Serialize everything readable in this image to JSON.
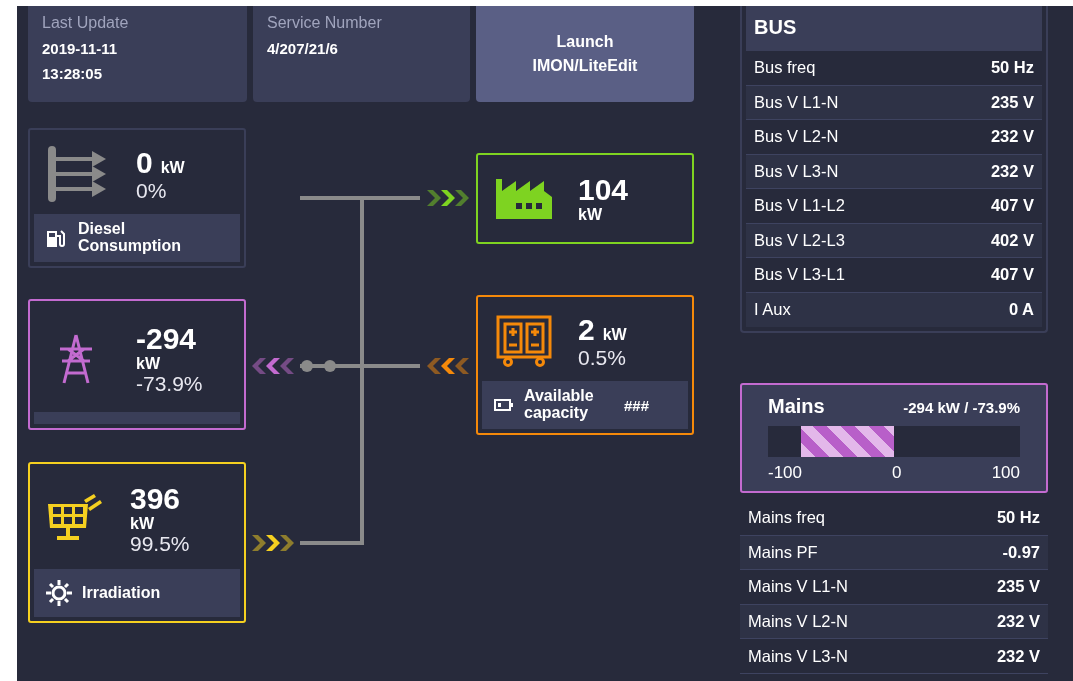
{
  "info_cards": [
    {
      "label": "Last Update",
      "lines": [
        "2019-11-11",
        "13:28:05"
      ]
    },
    {
      "label": "Service Number",
      "lines": [
        "4/207/21/6"
      ]
    }
  ],
  "launch_button": {
    "lines": [
      "Launch",
      "IMON/LiteEdit"
    ]
  },
  "nodes": [
    {
      "kind": "diesel",
      "color": "#3a3e58",
      "value": "0",
      "unit": "kW",
      "percent": "0%",
      "footer": {
        "label": "Diesel Consumption"
      }
    },
    {
      "kind": "mains",
      "color": "#c36bd0",
      "value": "-294",
      "unit": "kW",
      "percent": "-73.9%"
    },
    {
      "kind": "pv",
      "color": "#f5d020",
      "value": "396",
      "unit": "kW",
      "percent": "99.5%",
      "footer": {
        "label": "Irradiation"
      }
    },
    {
      "kind": "load",
      "color": "#7ed321",
      "value": "104",
      "unit": "kW"
    },
    {
      "kind": "battery",
      "color": "#f5890a",
      "value": "2",
      "unit": "kW",
      "percent": "0.5%",
      "footer": {
        "label": "Available capacity",
        "value": "###"
      }
    }
  ],
  "bus": {
    "title": "BUS",
    "rows": [
      {
        "label": "Bus freq",
        "value": "50 Hz"
      },
      {
        "label": "Bus V L1-N",
        "value": "235 V"
      },
      {
        "label": "Bus V L2-N",
        "value": "232 V"
      },
      {
        "label": "Bus V L3-N",
        "value": "232 V"
      },
      {
        "label": "Bus V L1-L2",
        "value": "407 V"
      },
      {
        "label": "Bus V L2-L3",
        "value": "402 V"
      },
      {
        "label": "Bus V L3-L1",
        "value": "407 V"
      },
      {
        "label": "I Aux",
        "value": "0 A"
      }
    ]
  },
  "mains": {
    "title": "Mains",
    "reading": "-294 kW / -73.9%",
    "level": 0.37,
    "ticks": [
      "-100",
      "0",
      "100"
    ],
    "rows": [
      {
        "label": "Mains freq",
        "value": "50 Hz"
      },
      {
        "label": "Mains PF",
        "value": "-0.97"
      },
      {
        "label": "Mains V L1-N",
        "value": "235 V"
      },
      {
        "label": "Mains V L2-N",
        "value": "232 V"
      },
      {
        "label": "Mains V L3-N",
        "value": "232 V"
      }
    ]
  }
}
